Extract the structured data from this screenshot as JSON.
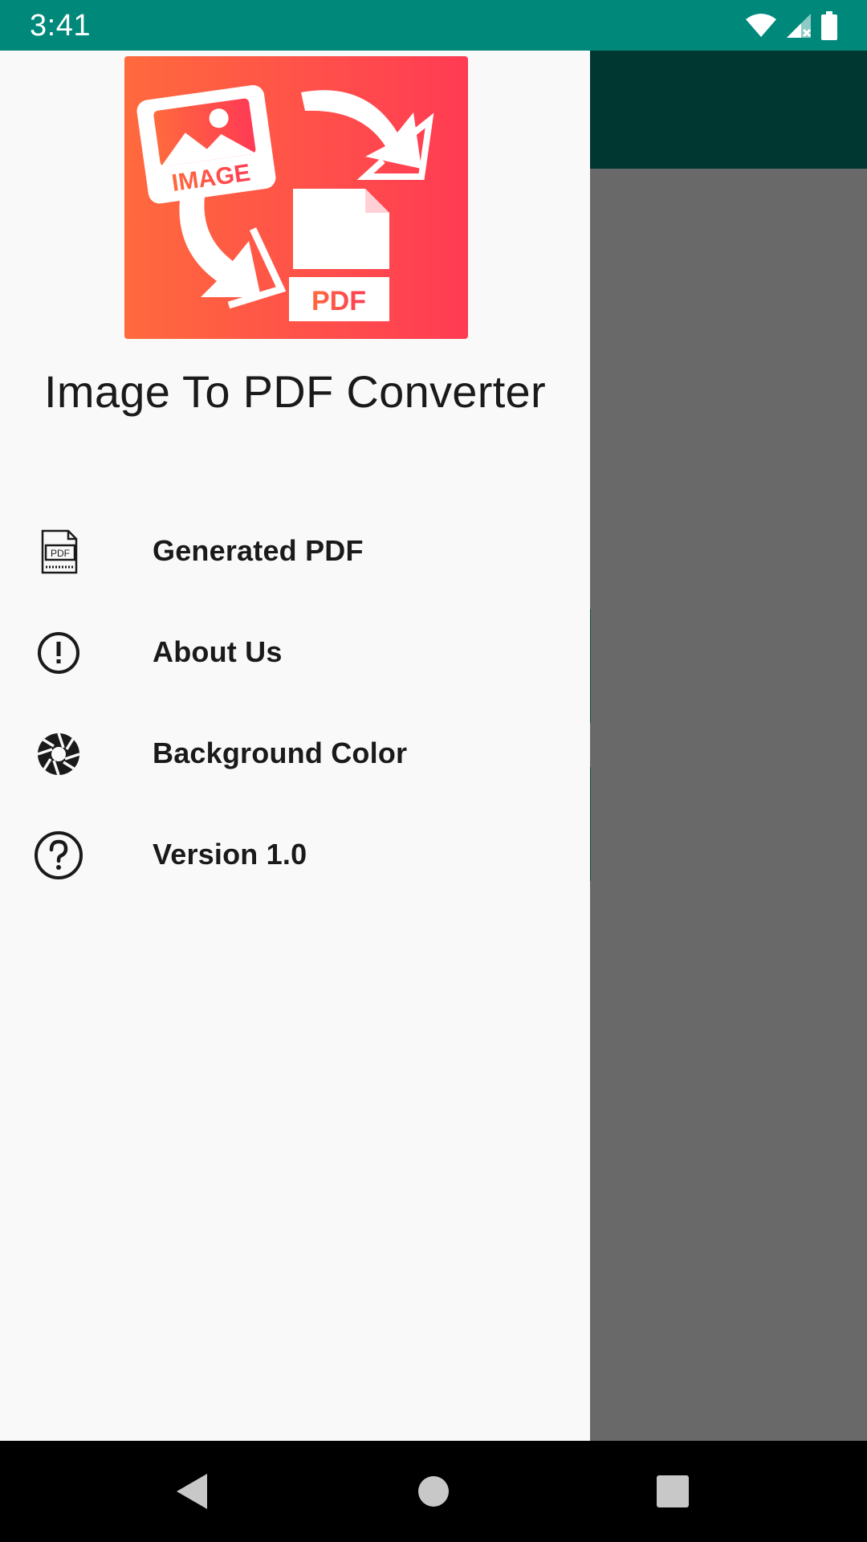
{
  "status_bar": {
    "time": "3:41",
    "icons": [
      "wifi-icon",
      "cellular-no-signal-icon",
      "battery-icon"
    ]
  },
  "drawer": {
    "logo": {
      "image_label": "IMAGE",
      "pdf_label": "PDF",
      "colors": {
        "start": "#ff6a3d",
        "end": "#ff3b54"
      }
    },
    "title": "Image To PDF Converter",
    "items": [
      {
        "label": "Generated PDF",
        "icon": "pdf-file-icon"
      },
      {
        "label": "About Us",
        "icon": "info-circle-icon"
      },
      {
        "label": "Background Color",
        "icon": "aperture-icon"
      },
      {
        "label": "Version 1.0",
        "icon": "help-circle-icon"
      }
    ]
  },
  "colors": {
    "status_bar": "#00897b",
    "toolbar": "#003730",
    "scrim": "#696969",
    "drawer_bg": "#f9f9f9",
    "text": "#1a1a1a"
  },
  "nav_bar": {
    "buttons": [
      "back-icon",
      "home-icon",
      "recents-icon"
    ]
  }
}
